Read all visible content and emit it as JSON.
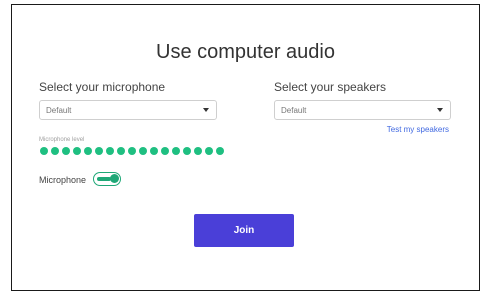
{
  "dialog": {
    "title": "Use computer audio"
  },
  "microphone": {
    "label": "Select your microphone",
    "selected": "Default",
    "level_label": "Microphone level",
    "level_dots": 17,
    "toggle_label": "Microphone",
    "toggle_on": true
  },
  "speakers": {
    "label": "Select your speakers",
    "selected": "Default",
    "test_link": "Test my speakers"
  },
  "actions": {
    "join_label": "Join"
  },
  "colors": {
    "accent": "#4a3fd8",
    "level_green": "#1fbf81",
    "link_blue": "#4169e1"
  }
}
